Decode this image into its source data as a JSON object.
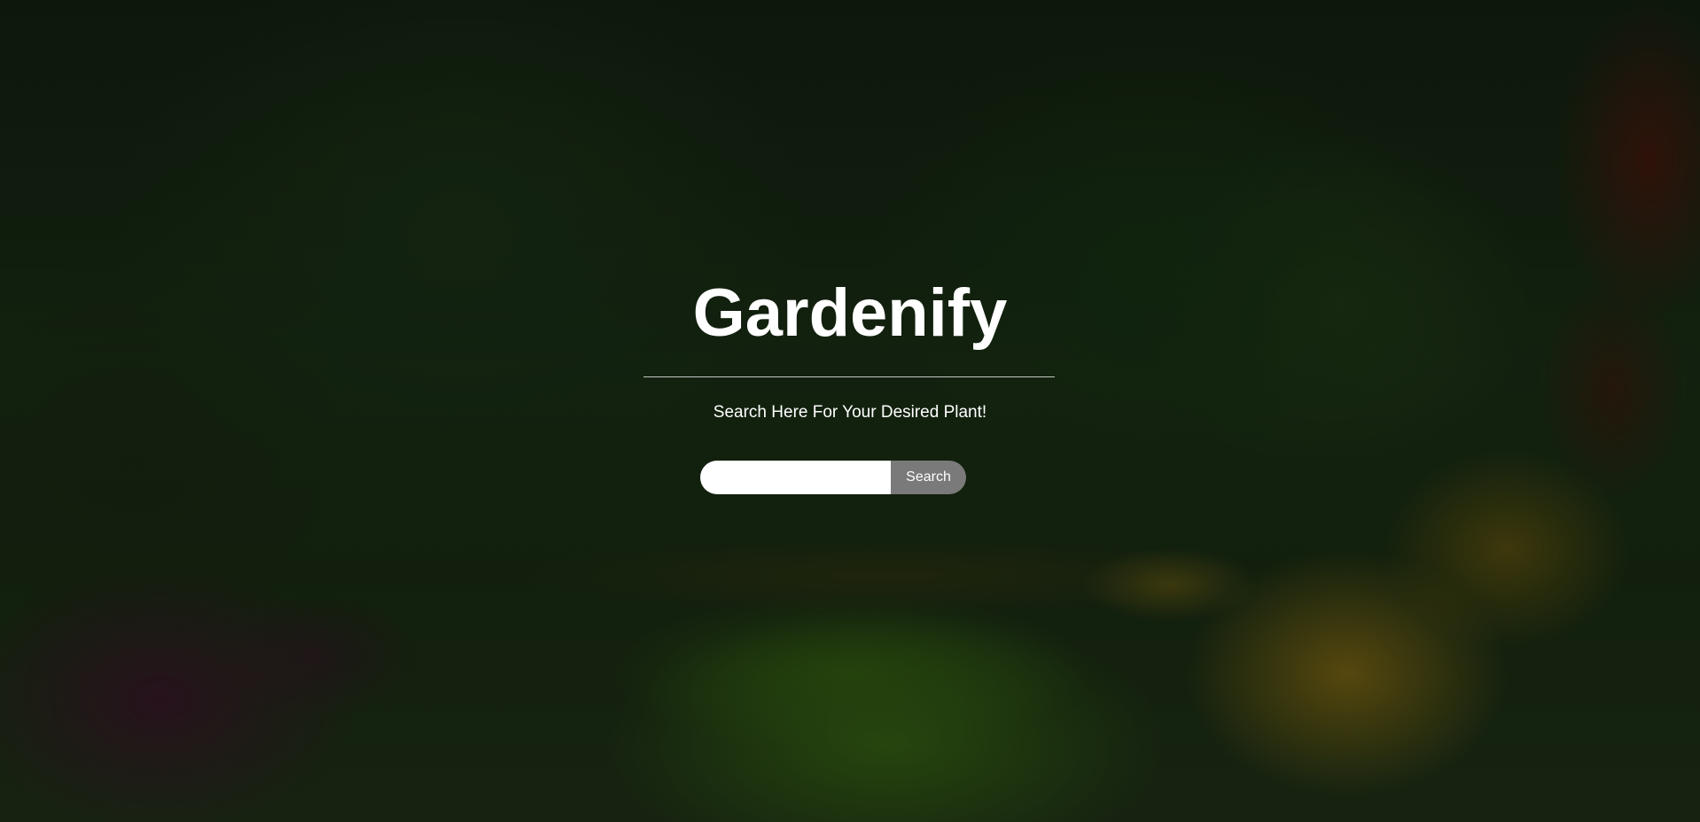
{
  "hero": {
    "title": "Gardenify",
    "subtitle": "Search Here For Your Desired Plant!"
  },
  "search": {
    "value": "",
    "placeholder": "",
    "button_label": "Search"
  },
  "colors": {
    "text": "#ffffff",
    "button_bg": "#7a7a7a",
    "input_bg": "#ffffff",
    "overlay": "rgba(0,0,0,0.35)"
  }
}
